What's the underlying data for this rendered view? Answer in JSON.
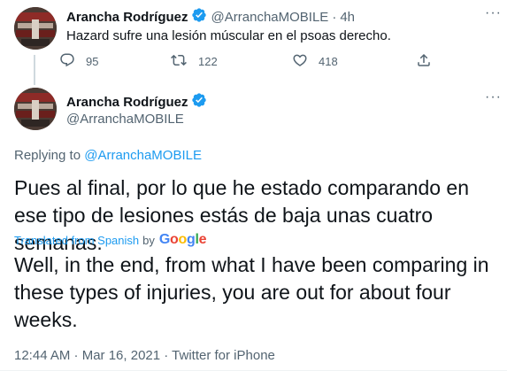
{
  "tweet1": {
    "author_name": "Arancha Rodríguez",
    "author_handle": "@ArranchaMOBILE",
    "time": "4h",
    "text": "Hazard sufre una lesión múscular en el psoas derecho.",
    "replies": "95",
    "retweets": "122",
    "likes": "418",
    "more_label": "···"
  },
  "tweet2": {
    "author_name": "Arancha Rodríguez",
    "author_handle": "@ArranchaMOBILE",
    "more_label": "···",
    "replying_prefix": "Replying to",
    "replying_handle": "@ArranchaMOBILE",
    "text": "Pues al final, por lo que he estado comparando en ese tipo de lesiones estás de baja unas cuatro semanas.",
    "translated_label": "Translated from Spanish",
    "translated_by": "by",
    "translation_provider": "Google",
    "translation": "Well, in the end, from what I have been comparing in these types of injuries, you are out for about four weeks.",
    "timestamp": "12:44 AM · Mar 16, 2021 · Twitter for iPhone"
  },
  "icons": {
    "verified": "verified-badge-icon",
    "reply": "reply-icon",
    "retweet": "retweet-icon",
    "like": "heart-icon",
    "share": "share-icon"
  },
  "colors": {
    "accent": "#1d9bf0",
    "secondary_text": "#536471",
    "primary_text": "#0f1419",
    "thread_line": "#cfd9de"
  }
}
